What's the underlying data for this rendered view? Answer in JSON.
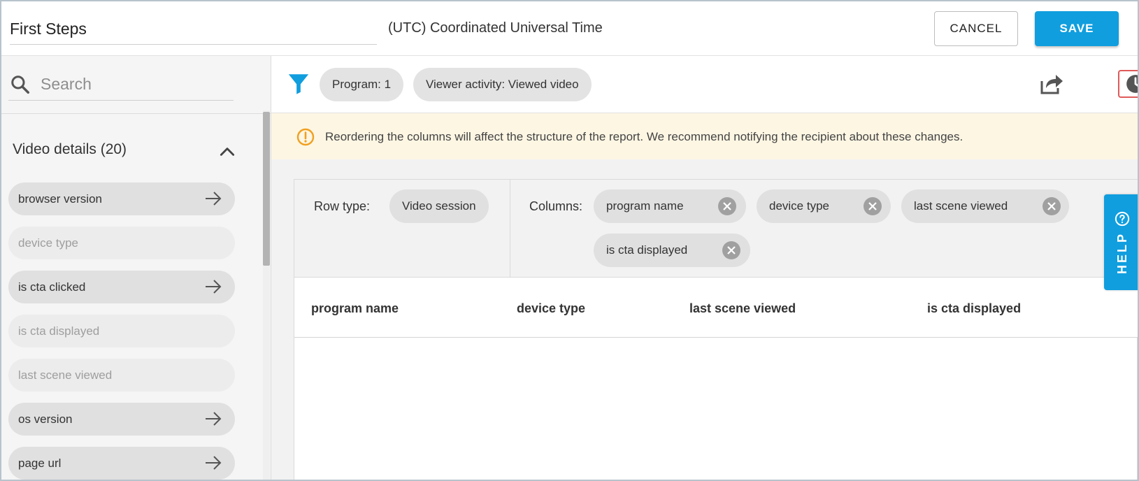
{
  "header": {
    "report_name": "First Steps",
    "timezone": "(UTC) Coordinated Universal Time",
    "cancel_label": "CANCEL",
    "save_label": "SAVE"
  },
  "sidebar": {
    "search_placeholder": "Search",
    "section_title": "Video details (20)",
    "items": [
      {
        "label": "browser version",
        "enabled": true
      },
      {
        "label": "device type",
        "enabled": false
      },
      {
        "label": "is cta clicked",
        "enabled": true
      },
      {
        "label": "is cta displayed",
        "enabled": false
      },
      {
        "label": "last scene viewed",
        "enabled": false
      },
      {
        "label": "os version",
        "enabled": true
      },
      {
        "label": "page url",
        "enabled": true
      }
    ]
  },
  "filters": {
    "chips": [
      "Program: 1",
      "Viewer activity: Viewed video"
    ]
  },
  "notice": {
    "text": "Reordering the columns will affect the structure of the report. We recommend notifying the recipient about these changes."
  },
  "config": {
    "row_type_label": "Row type:",
    "row_type_value": "Video session",
    "columns_label": "Columns:",
    "columns": [
      "program name",
      "device type",
      "last scene viewed",
      "is cta displayed"
    ]
  },
  "table": {
    "headers": [
      "program name",
      "device type",
      "last scene viewed",
      "is cta displayed"
    ]
  },
  "help": {
    "label": "HELP"
  },
  "icons": {
    "search": "search-icon",
    "collapse": "chevron-up-icon",
    "arrow": "arrow-right-icon",
    "filter": "filter-icon",
    "share": "share-icon",
    "history": "clock-icon",
    "warning": "warning-icon",
    "remove": "close-icon",
    "help": "help-icon"
  },
  "colors": {
    "primary": "#109ede",
    "warning": "#f0a020",
    "notice_bg": "#fdf6e3",
    "highlight": "#e05a5a"
  }
}
